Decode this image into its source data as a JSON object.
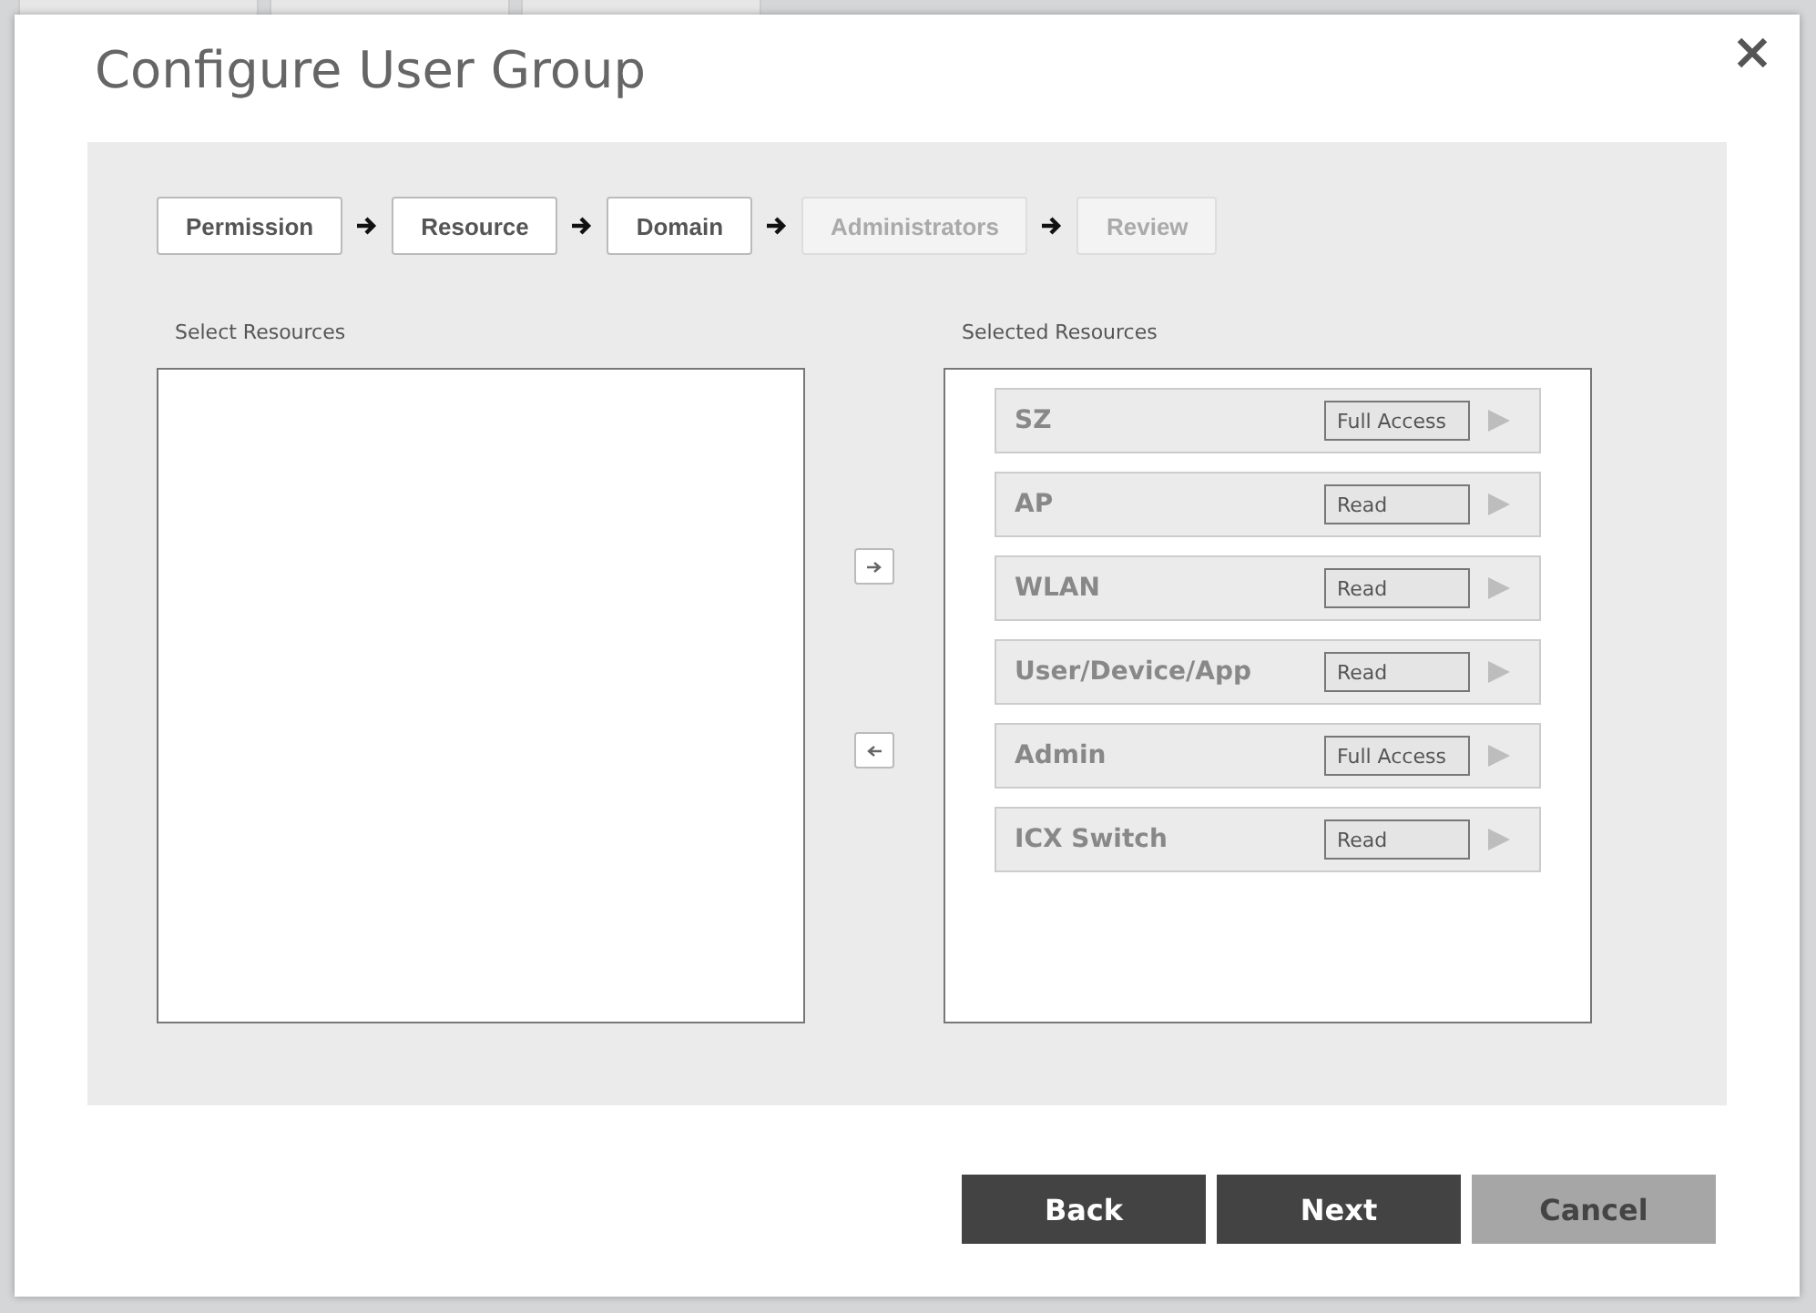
{
  "dialog": {
    "title": "Configure User Group"
  },
  "steps": [
    {
      "label": "Permission",
      "disabled": false
    },
    {
      "label": "Resource",
      "disabled": false
    },
    {
      "label": "Domain",
      "disabled": false
    },
    {
      "label": "Administrators",
      "disabled": true
    },
    {
      "label": "Review",
      "disabled": true
    }
  ],
  "select_resources": {
    "label": "Select Resources"
  },
  "selected_resources": {
    "label": "Selected Resources",
    "items": [
      {
        "name": "SZ",
        "access": "Full Access"
      },
      {
        "name": "AP",
        "access": "Read"
      },
      {
        "name": "WLAN",
        "access": "Read"
      },
      {
        "name": "User/Device/App",
        "access": "Read"
      },
      {
        "name": "Admin",
        "access": "Full Access"
      },
      {
        "name": "ICX Switch",
        "access": "Read"
      }
    ]
  },
  "footer_buttons": [
    {
      "label": "Back",
      "kind": "primary"
    },
    {
      "label": "Next",
      "kind": "primary"
    },
    {
      "label": "Cancel",
      "kind": "secondary"
    }
  ]
}
